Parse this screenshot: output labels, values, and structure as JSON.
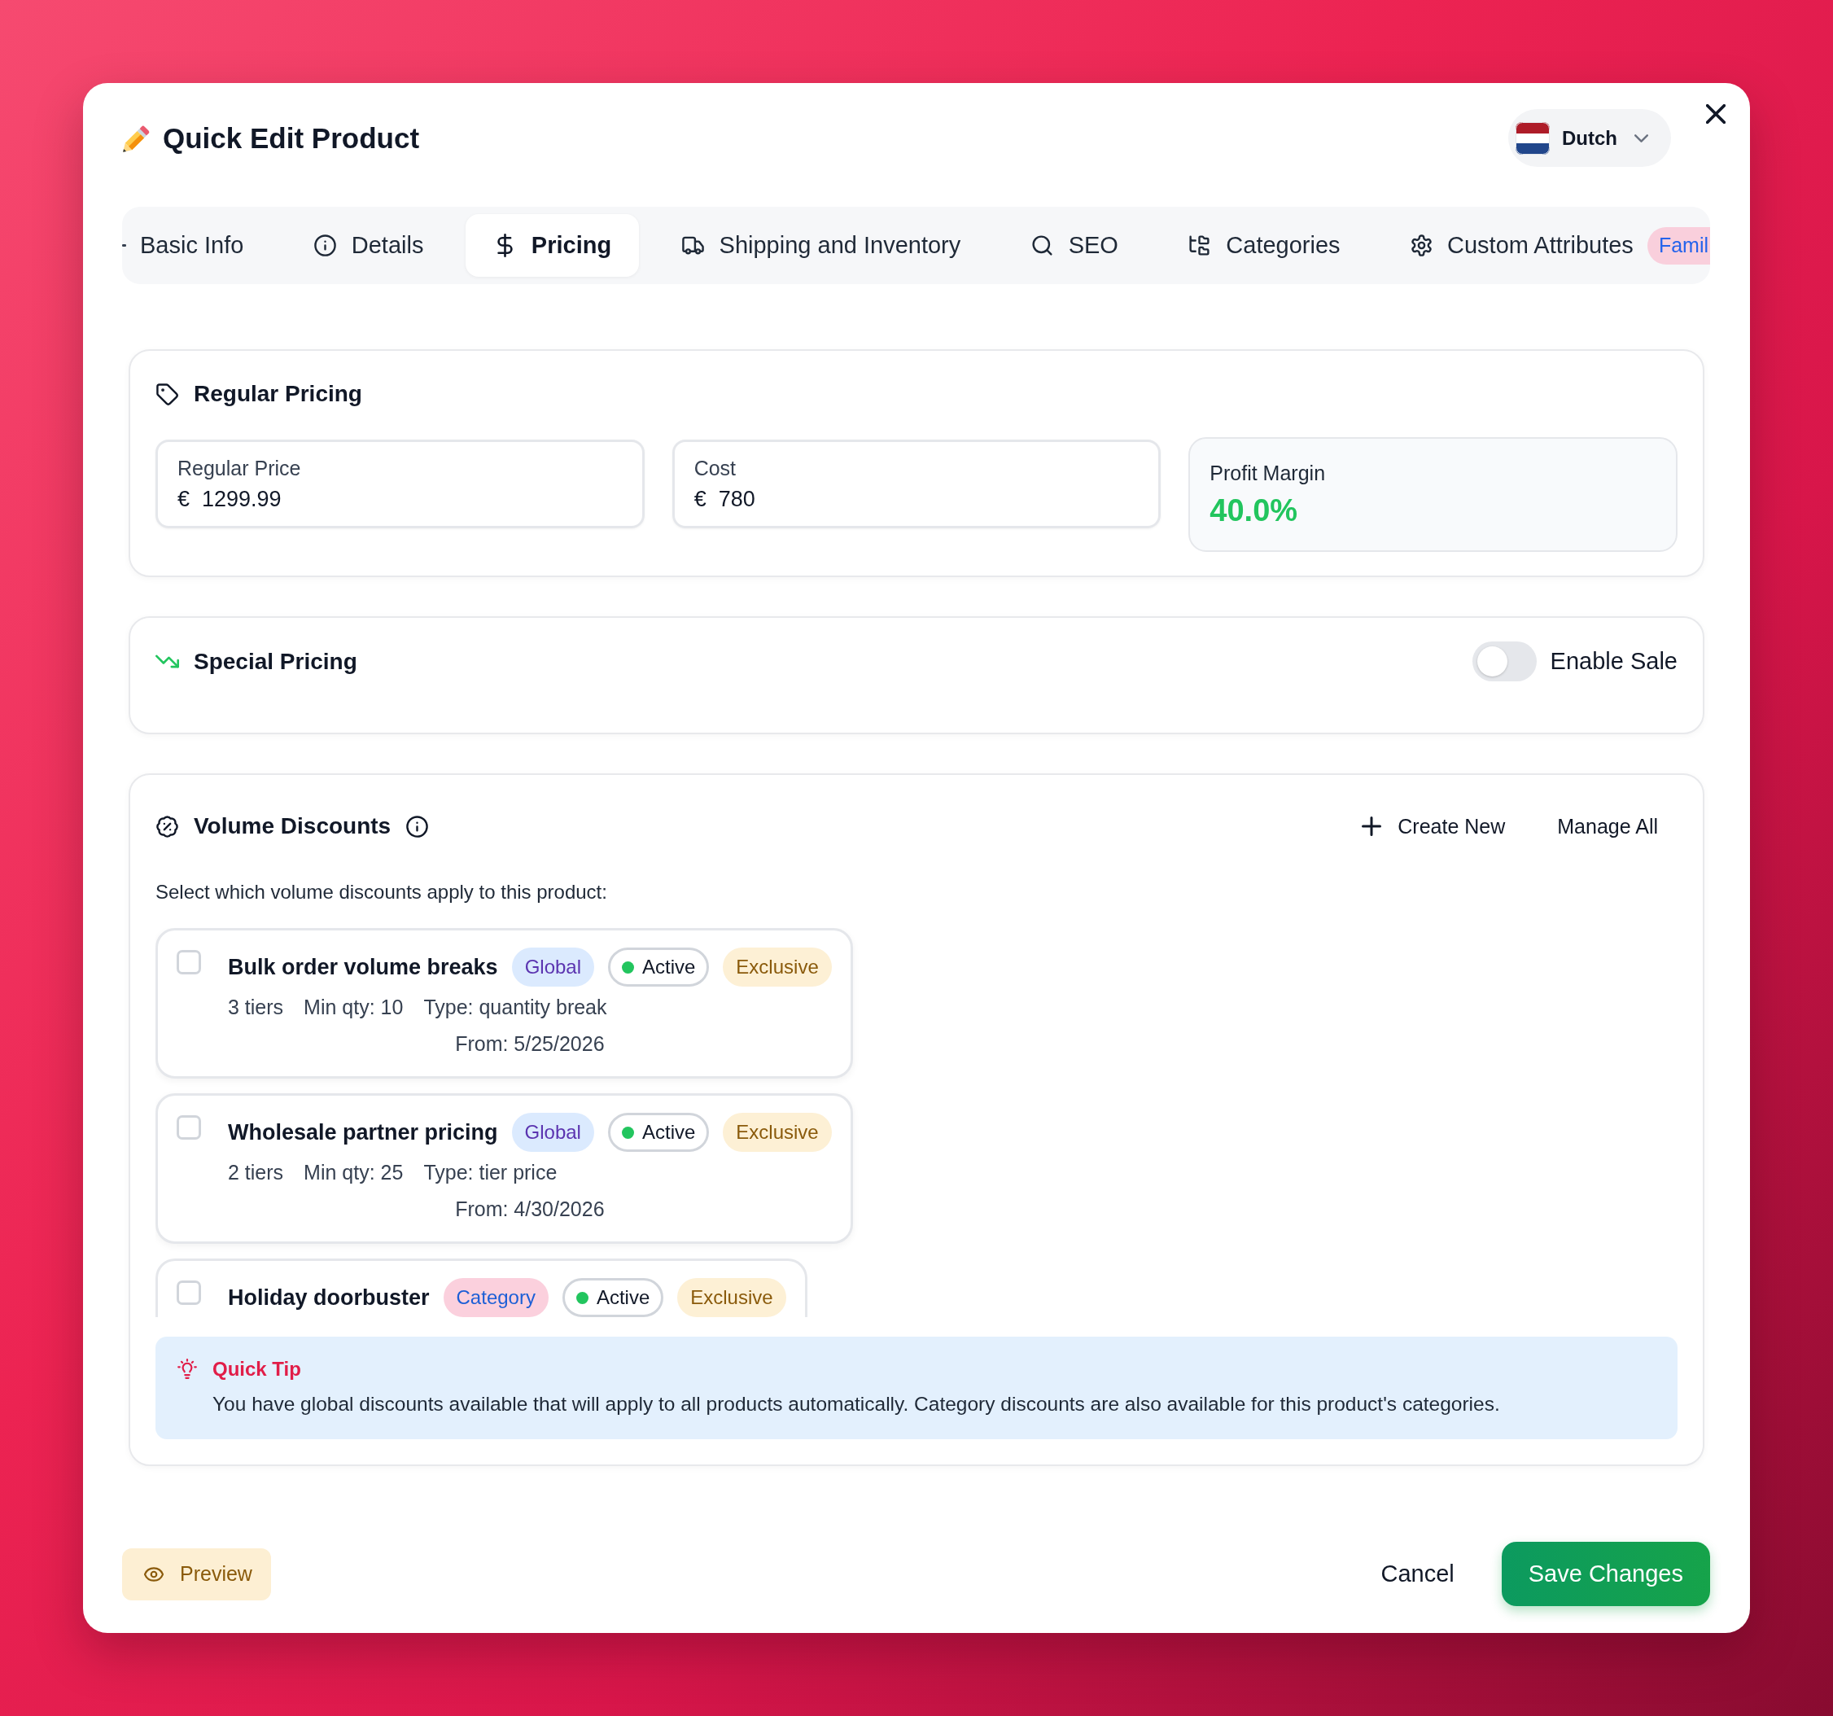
{
  "dialog": {
    "title": "Quick Edit Product",
    "language": "Dutch"
  },
  "tabs": [
    {
      "label": "Basic Info",
      "selected": false
    },
    {
      "label": "Details",
      "selected": false
    },
    {
      "label": "Pricing",
      "selected": true
    },
    {
      "label": "Shipping and Inventory",
      "selected": false
    },
    {
      "label": "SEO",
      "selected": false
    },
    {
      "label": "Categories",
      "selected": false
    },
    {
      "label": "Custom Attributes",
      "selected": false,
      "badge": "Famil"
    }
  ],
  "regular_pricing": {
    "title": "Regular Pricing",
    "fields": [
      {
        "label": "Regular Price",
        "currency": "€",
        "value": "1299.99"
      },
      {
        "label": "Cost",
        "currency": "€",
        "value": "780"
      }
    ],
    "profit_margin": {
      "label": "Profit Margin",
      "value": "40.0%"
    }
  },
  "special_pricing": {
    "title": "Special Pricing",
    "sale_toggle": {
      "label": "Enable Sale",
      "on": false
    }
  },
  "volume_discounts": {
    "title": "Volume Discounts",
    "actions": [
      {
        "label": "Create New",
        "kind": "add"
      },
      {
        "label": "Manage All",
        "kind": "plain"
      }
    ],
    "prompt": "Select which volume discounts apply to this product:",
    "discounts": [
      {
        "name": "Bulk order volume breaks",
        "checked": false,
        "scope": {
          "label": "Global",
          "kind": "global"
        },
        "status": "Active",
        "tag": "Exclusive",
        "details": [
          "3 tiers",
          "Min qty: 10",
          "Type: quantity break"
        ],
        "from": "From: 5/25/2026"
      },
      {
        "name": "Wholesale partner pricing",
        "checked": false,
        "scope": {
          "label": "Global",
          "kind": "global"
        },
        "status": "Active",
        "tag": "Exclusive",
        "details": [
          "2 tiers",
          "Min qty: 25",
          "Type: tier price"
        ],
        "from": "From: 4/30/2026"
      },
      {
        "name": "Holiday doorbuster",
        "checked": false,
        "scope": {
          "label": "Category",
          "kind": "category"
        },
        "status": "Active",
        "tag": "Exclusive"
      }
    ],
    "quick_tip": {
      "title": "Quick Tip",
      "text": "You have global discounts available that will apply to all products automatically. Category discounts are also available for this product's categories."
    }
  },
  "footer": {
    "preview": "Preview",
    "cancel": "Cancel",
    "save": "Save Changes"
  }
}
